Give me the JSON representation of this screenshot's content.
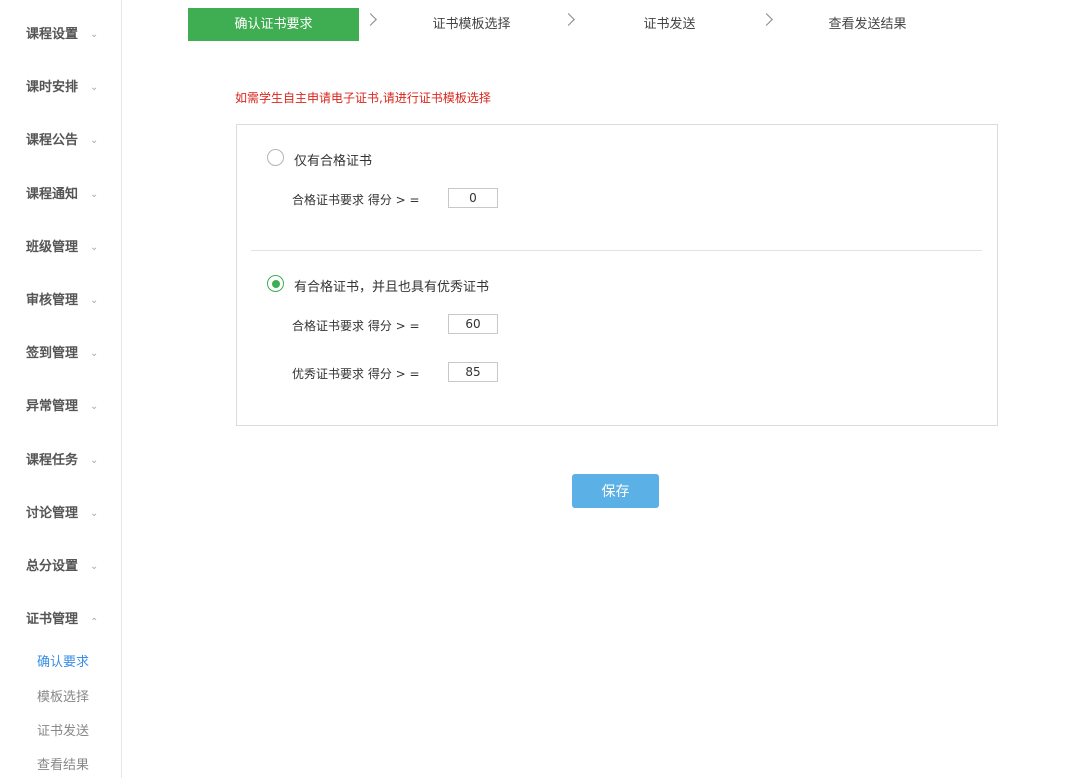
{
  "sidebar": {
    "items": [
      {
        "label": "课程设置",
        "chevron": "chevron-down-icon"
      },
      {
        "label": "课时安排",
        "chevron": "chevron-down-icon"
      },
      {
        "label": "课程公告",
        "chevron": "chevron-down-icon"
      },
      {
        "label": "课程通知",
        "chevron": "chevron-down-icon"
      },
      {
        "label": "班级管理",
        "chevron": "chevron-down-icon"
      },
      {
        "label": "审核管理",
        "chevron": "chevron-down-icon"
      },
      {
        "label": "签到管理",
        "chevron": "chevron-down-icon"
      },
      {
        "label": "异常管理",
        "chevron": "chevron-down-icon"
      },
      {
        "label": "课程任务",
        "chevron": "chevron-down-icon"
      },
      {
        "label": "讨论管理",
        "chevron": "chevron-down-icon"
      },
      {
        "label": "总分设置",
        "chevron": "chevron-down-icon"
      },
      {
        "label": "证书管理",
        "chevron": "chevron-up-icon"
      }
    ],
    "subitems": [
      {
        "label": "确认要求",
        "active": true
      },
      {
        "label": "模板选择",
        "active": false
      },
      {
        "label": "证书发送",
        "active": false
      },
      {
        "label": "查看结果",
        "active": false
      }
    ]
  },
  "steps": [
    {
      "label": "确认证书要求",
      "active": true
    },
    {
      "label": "证书模板选择",
      "active": false
    },
    {
      "label": "证书发送",
      "active": false
    },
    {
      "label": "查看发送结果",
      "active": false
    }
  ],
  "hint": "如需学生自主申请电子证书,请进行证书模板选择",
  "options": {
    "opt1": {
      "label": "仅有合格证书",
      "checked": false,
      "pass_label": "合格证书要求 得分 > =",
      "pass_value": "0"
    },
    "opt2": {
      "label": "有合格证书，并且也具有优秀证书",
      "checked": true,
      "pass_label": "合格证书要求 得分 > =",
      "pass_value": "60",
      "excellent_label": "优秀证书要求 得分 > =",
      "excellent_value": "85"
    }
  },
  "save_label": "保存",
  "colors": {
    "accent_green": "#3fae52",
    "save_blue": "#5bb0e6",
    "hint_red": "#d9261c",
    "active_link": "#3a8ee6"
  }
}
